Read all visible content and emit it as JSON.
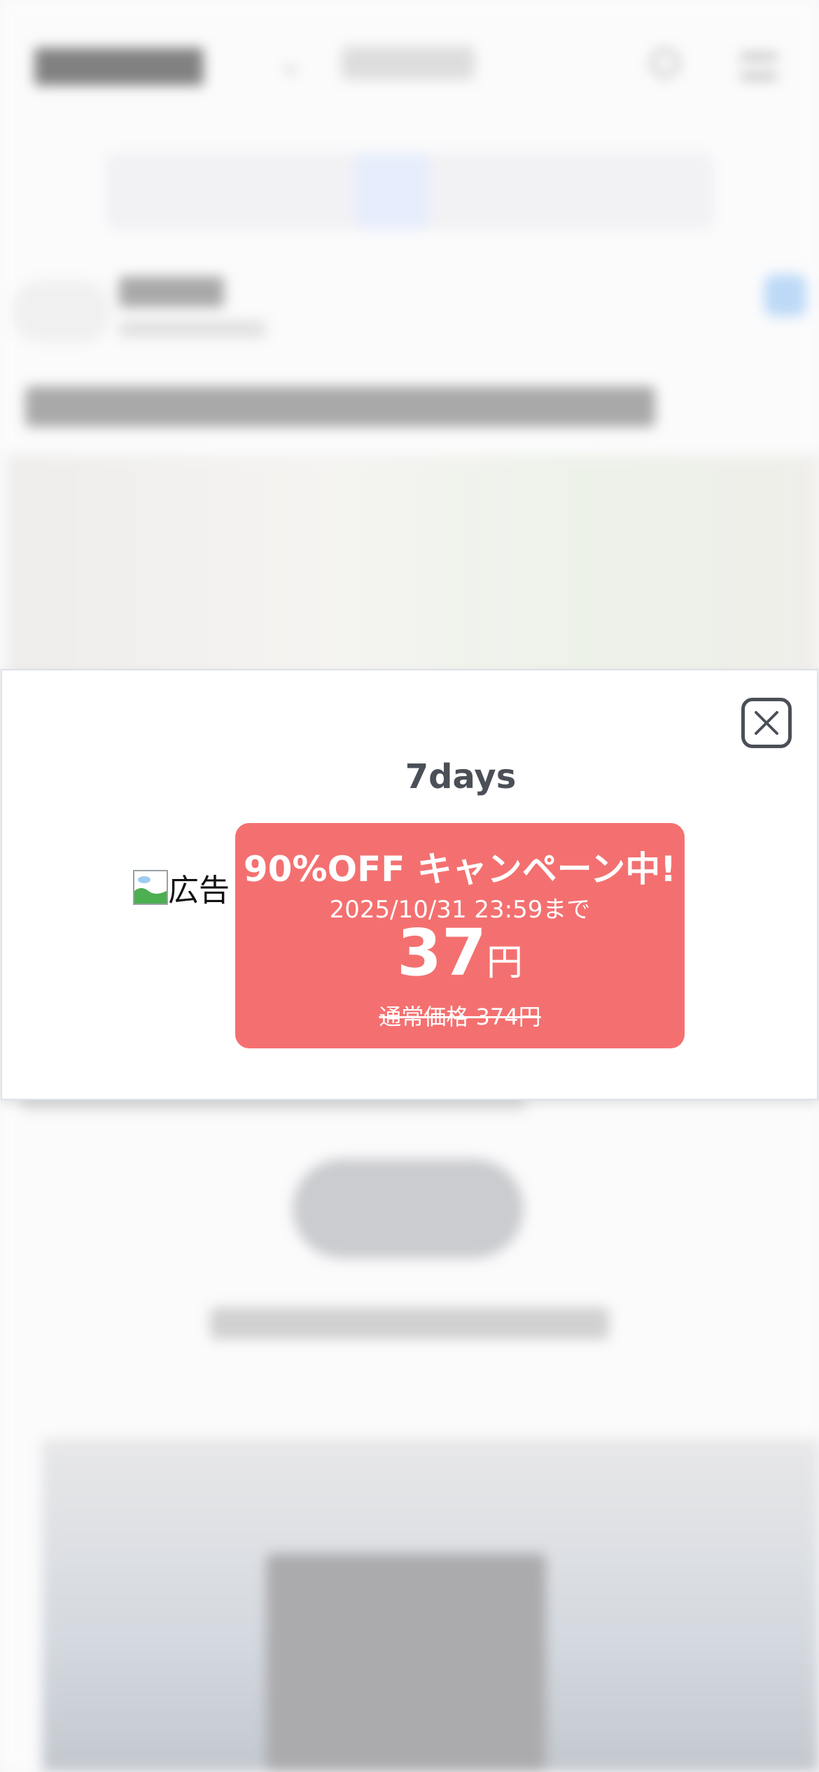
{
  "modal": {
    "title": "7days",
    "close_icon": "close-icon",
    "ad_image": {
      "alt": "広告",
      "icon": "broken-image-icon"
    },
    "promo": {
      "headline": "90%OFF キャンペーン中!",
      "deadline": "2025/10/31 23:59まで",
      "price": "37",
      "price_unit": "円",
      "regular_price": "通常価格 374円"
    },
    "colors": {
      "promo_background": "#f47070",
      "title_text": "#4b4f57",
      "close_border": "#4b4f57"
    }
  },
  "background": {
    "state": "blurred",
    "colors": {
      "page": "#ffffff",
      "pager_active": "#dbe6ff",
      "follow_button": "#8ec2f7"
    }
  }
}
